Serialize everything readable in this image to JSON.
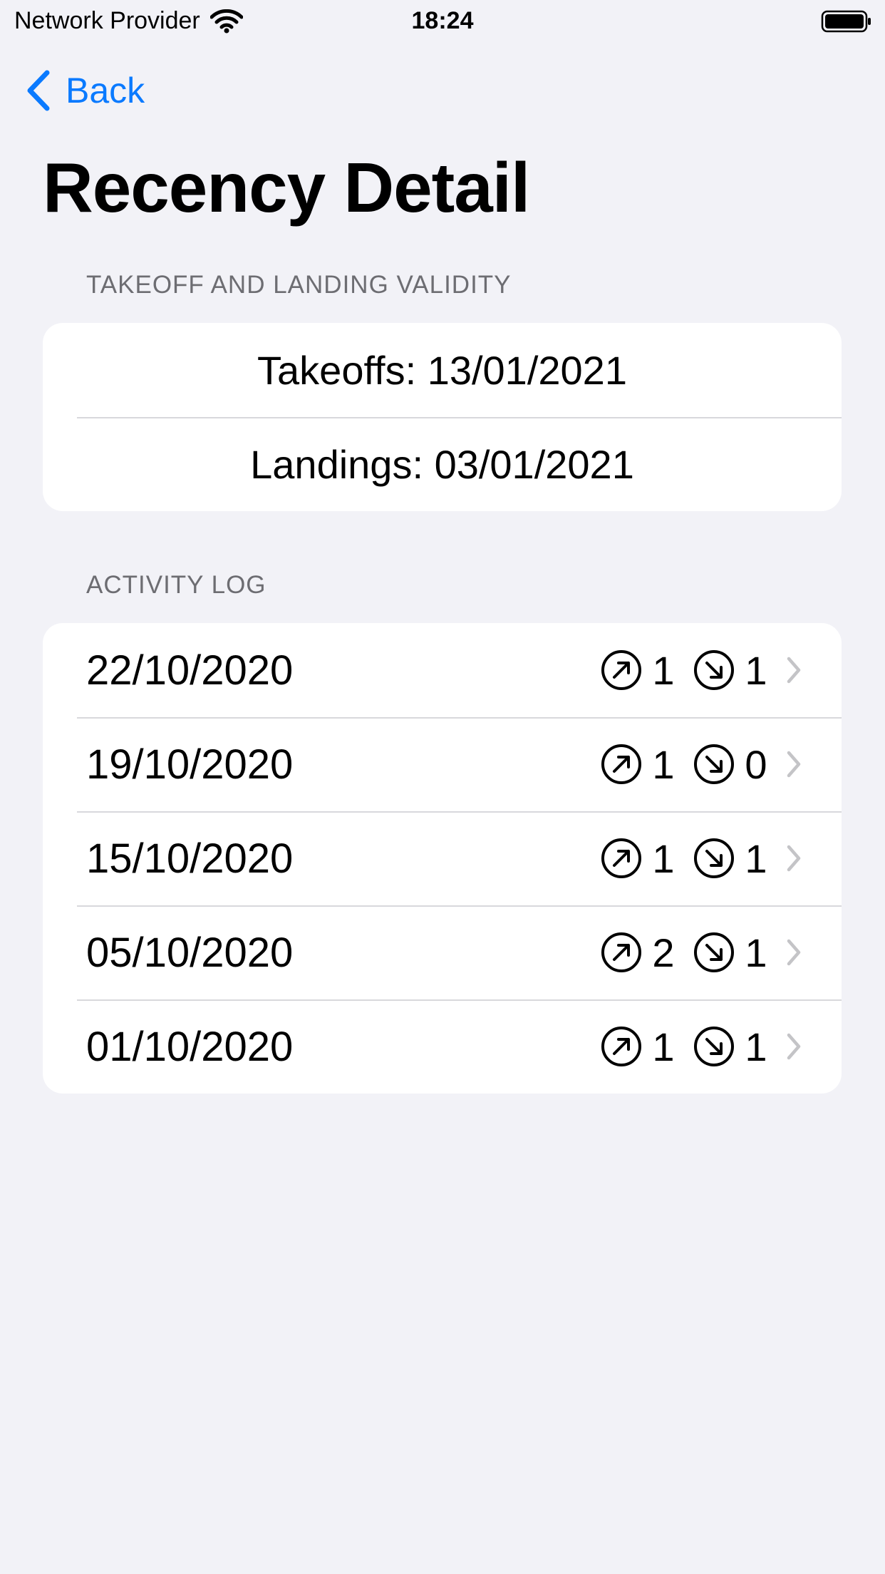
{
  "status_bar": {
    "carrier": "Network Provider",
    "time": "18:24"
  },
  "nav": {
    "back_label": "Back"
  },
  "page_title": "Recency Detail",
  "validity": {
    "header": "TAKEOFF AND LANDING VALIDITY",
    "takeoffs": "Takeoffs: 13/01/2021",
    "landings": "Landings: 03/01/2021"
  },
  "activity": {
    "header": "ACTIVITY LOG",
    "rows": [
      {
        "date": "22/10/2020",
        "takeoffs": "1",
        "landings": "1"
      },
      {
        "date": "19/10/2020",
        "takeoffs": "1",
        "landings": "0"
      },
      {
        "date": "15/10/2020",
        "takeoffs": "1",
        "landings": "1"
      },
      {
        "date": "05/10/2020",
        "takeoffs": "2",
        "landings": "1"
      },
      {
        "date": "01/10/2020",
        "takeoffs": "1",
        "landings": "1"
      }
    ]
  },
  "icons": {
    "takeoff": "arrow-up-right-circle-icon",
    "landing": "arrow-down-right-circle-icon",
    "disclosure": "chevron-right-icon"
  },
  "colors": {
    "accent": "#0a7aff",
    "background": "#f2f2f7",
    "secondary_text": "#6d6d72",
    "chevron": "#c4c4c7"
  }
}
